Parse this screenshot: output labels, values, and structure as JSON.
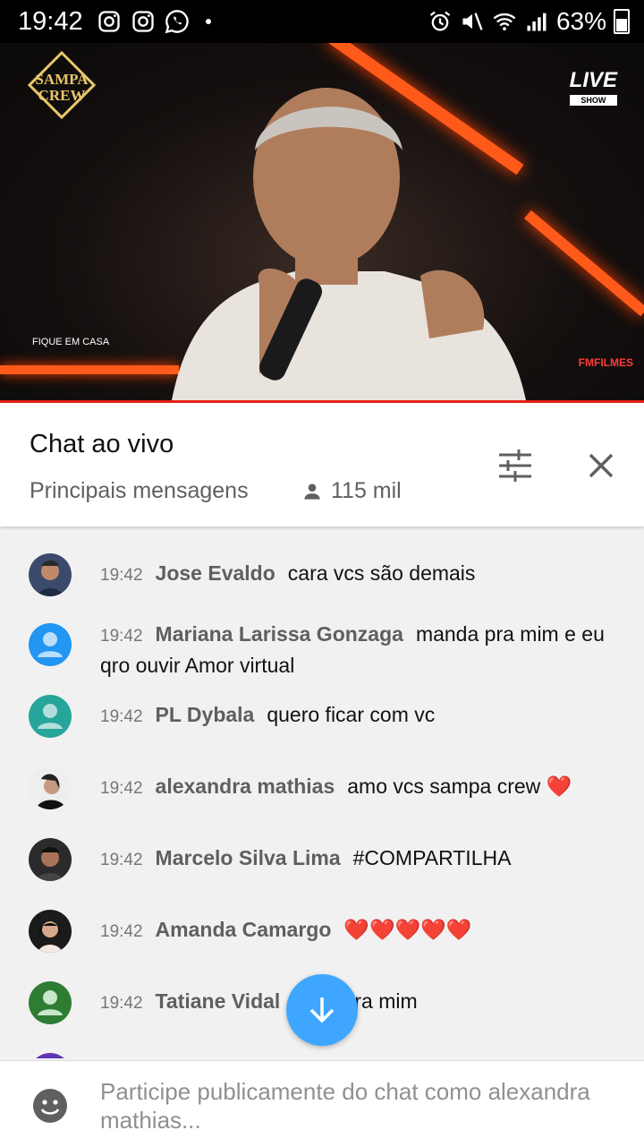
{
  "status_bar": {
    "time": "19:42",
    "battery_pct": "63%",
    "left_icons": [
      "instagram-icon",
      "instagram-icon",
      "whatsapp-icon"
    ],
    "right_icons": [
      "alarm-icon",
      "mute-icon",
      "wifi-icon",
      "signal-icon",
      "battery-icon"
    ]
  },
  "video": {
    "logo_left": "SAMPA CREW",
    "logo_right": "LIVE",
    "logo_right_sub": "SHOW",
    "overlay_left": "FIQUE EM CASA",
    "overlay_right": "FMFILMES",
    "progress_color": "#e62117"
  },
  "chat_header": {
    "title": "Chat ao vivo",
    "subtitle": "Principais mensagens",
    "viewers": "115 mil"
  },
  "messages": [
    {
      "time": "19:42",
      "author": "Jose Evaldo",
      "text": "cara vcs são demais",
      "avatar": "photo"
    },
    {
      "time": "19:42",
      "author": "Mariana Larissa Gonzaga",
      "text": "manda pra mim e eu qro ouvir Amor virtual",
      "avatar": "default-blue"
    },
    {
      "time": "19:42",
      "author": "PL Dybala",
      "text": "quero ficar com vc",
      "avatar": "default-teal"
    },
    {
      "time": "19:42",
      "author": "alexandra mathias",
      "text": "amo vcs sampa crew",
      "emoji": "❤️",
      "avatar": "photo"
    },
    {
      "time": "19:42",
      "author": "Marcelo Silva Lima",
      "text": "#COMPARTILHA",
      "avatar": "photo"
    },
    {
      "time": "19:42",
      "author": "Amanda Camargo",
      "text": "",
      "emoji": "❤️❤️❤️❤️❤️",
      "avatar": "photo"
    },
    {
      "time": "19:42",
      "author": "Tatiane Vidal",
      "text": "a bjo pra mim",
      "avatar": "default-green"
    }
  ],
  "input": {
    "placeholder": "Participe publicamente do chat como alexandra mathias..."
  },
  "colors": {
    "accent": "#3ea6ff",
    "heart": "#e01b24"
  }
}
